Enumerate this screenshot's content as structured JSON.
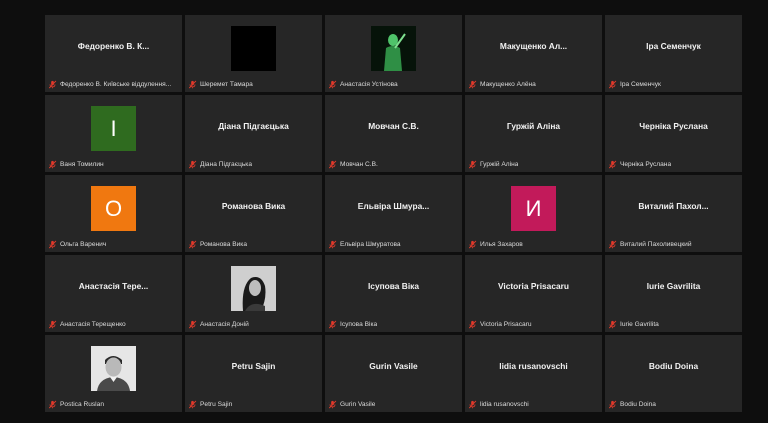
{
  "participants": [
    {
      "display": "Федоренко В. К...",
      "label": "Федоренко В. Київське віддулення...",
      "type": "name"
    },
    {
      "display": "",
      "label": "Шеремет Тамара",
      "type": "video-dark"
    },
    {
      "display": "",
      "label": "Анастасія Устінова",
      "type": "video-figure"
    },
    {
      "display": "Макущенко Ал...",
      "label": "Макущенко Алёна",
      "type": "name"
    },
    {
      "display": "Іра Семенчук",
      "label": "Іра Семенчук",
      "type": "name"
    },
    {
      "display": "I",
      "label": "Ваня Томилин",
      "type": "avatar",
      "color": "#2f6b1f"
    },
    {
      "display": "Діана Підгаєцька",
      "label": "Діана Підгаєцька",
      "type": "name"
    },
    {
      "display": "Мовчан С.В.",
      "label": "Мовчан С.В.",
      "type": "name"
    },
    {
      "display": "Гуржій Аліна",
      "label": "Гуржій Аліна",
      "type": "name"
    },
    {
      "display": "Черніка Руслана",
      "label": "Черніка Руслана",
      "type": "name"
    },
    {
      "display": "О",
      "label": "Ольга Варенич",
      "type": "avatar",
      "color": "#f07810"
    },
    {
      "display": "Романова Вика",
      "label": "Романова Вика",
      "type": "name"
    },
    {
      "display": "Ельвіра Шмура...",
      "label": "Ельвіра Шмуратова",
      "type": "name"
    },
    {
      "display": "И",
      "label": "Илья Захаров",
      "type": "avatar",
      "color": "#c21a5a"
    },
    {
      "display": "Виталий Пахол...",
      "label": "Виталий Пахоливецкий",
      "type": "name"
    },
    {
      "display": "Анастасія Тере...",
      "label": "Анастасія Терещенко",
      "type": "name"
    },
    {
      "display": "",
      "label": "Анастасія Доній",
      "type": "photo-bw"
    },
    {
      "display": "Ісупова Віка",
      "label": "Ісупова Віка",
      "type": "name"
    },
    {
      "display": "Victoria Prisacaru",
      "label": "Victoria Prisacaru",
      "type": "name"
    },
    {
      "display": "Iurie Gavrilita",
      "label": "Iurie Gavrilita",
      "type": "name"
    },
    {
      "display": "",
      "label": "Postica Ruslan",
      "type": "photo-man"
    },
    {
      "display": "Petru Sajin",
      "label": "Petru Sajin",
      "type": "name"
    },
    {
      "display": "Gurin Vasile",
      "label": "Gurin Vasile",
      "type": "name"
    },
    {
      "display": "lidia rusanovschi",
      "label": "lidia rusanovschi",
      "type": "name"
    },
    {
      "display": "Bodiu Doina",
      "label": "Bodiu Doina",
      "type": "name"
    }
  ],
  "icons": {
    "muted": "mic-muted-icon"
  },
  "colors": {
    "tile_bg": "#262626",
    "page_bg": "#0e0e0e",
    "muted_red": "#e0392b"
  }
}
